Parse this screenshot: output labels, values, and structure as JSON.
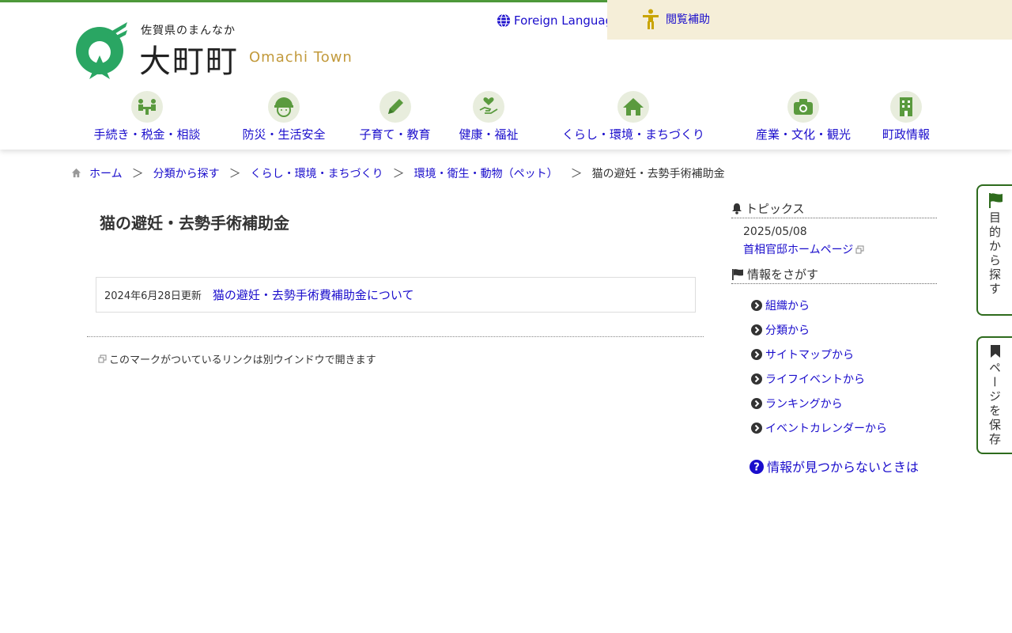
{
  "header": {
    "logo_sub": "佐賀県のまんなか",
    "logo_main": "大町町",
    "logo_en": "Omachi Town",
    "foreign_language": "Foreign Language",
    "assist": "閲覧補助"
  },
  "nav": [
    {
      "label": "手続き・税金・相談",
      "icon": "people-table-icon"
    },
    {
      "label": "防災・生活安全",
      "icon": "helmet-icon"
    },
    {
      "label": "子育て・教育",
      "icon": "pencil-icon"
    },
    {
      "label": "健康・福祉",
      "icon": "heart-hand-icon"
    },
    {
      "label": "くらし・環境・まちづくり",
      "icon": "house-icon"
    },
    {
      "label": "産業・文化・観光",
      "icon": "camera-icon"
    },
    {
      "label": "町政情報",
      "icon": "building-icon"
    }
  ],
  "breadcrumb": {
    "home": "ホーム",
    "items": [
      "分類から探す",
      "くらし・環境・まちづくり",
      "環境・衛生・動物（ペット）"
    ],
    "current": "猫の避妊・去勢手術補助金"
  },
  "main": {
    "title": "猫の避妊・去勢手術補助金",
    "news": {
      "date": "2024年6月28日更新",
      "link": "猫の避妊・去勢手術費補助金について"
    },
    "note": "このマークがついているリンクは別ウインドウで開きます"
  },
  "sidebar": {
    "topics_heading": "トピックス",
    "topic_date": "2025/05/08",
    "topic_link": "首相官邸ホームページ",
    "search_heading": "情報をさがす",
    "search_items": [
      "組織から",
      "分類から",
      "サイトマップから",
      "ライフイベントから",
      "ランキングから",
      "イベントカレンダーから"
    ],
    "not_found": "情報が見つからないときは"
  },
  "tabs": {
    "purpose": "目的から探す",
    "save": "ページを保存"
  },
  "colors": {
    "accent_green": "#4e9a3a",
    "link": "#1a0dcc",
    "tab_border": "#2e6b1d",
    "assist_bg": "#f5eed8"
  }
}
